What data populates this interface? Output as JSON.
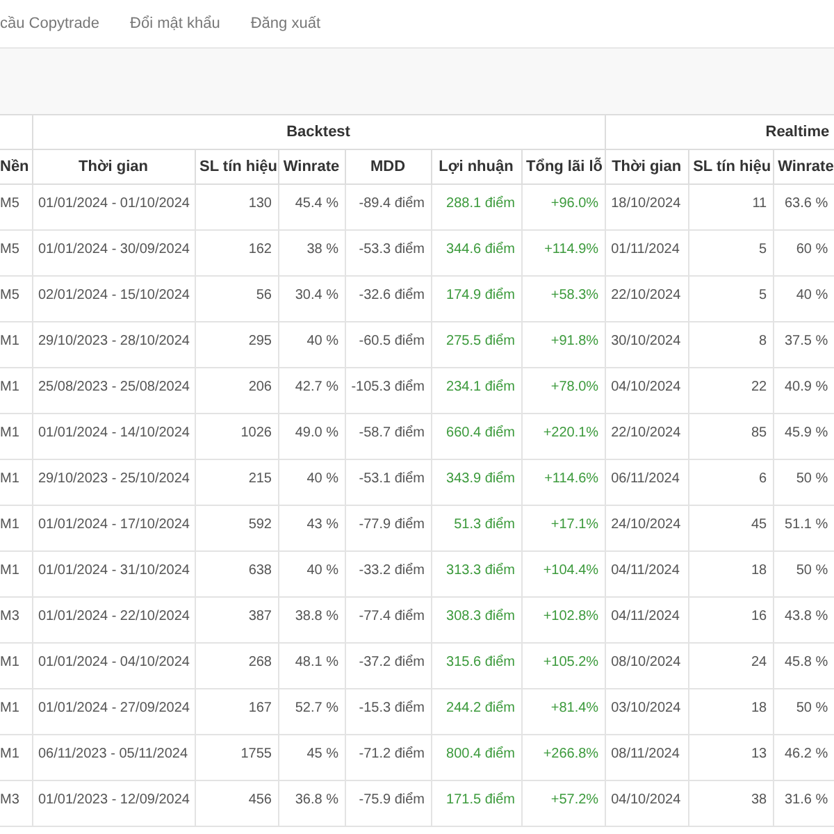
{
  "nav": {
    "items": [
      "cầu Copytrade",
      "Đổi mật khẩu",
      "Đăng xuất"
    ]
  },
  "table": {
    "groups": [
      {
        "label": "Backtest"
      },
      {
        "label": "Realtime"
      }
    ],
    "columns": [
      "Nền",
      "Thời gian",
      "SL tín hiệu",
      "Winrate",
      "MDD",
      "Lợi nhuận",
      "Tổng lãi lỗ",
      "Thời gian",
      "SL tín hiệu",
      "Winrate"
    ],
    "rows": [
      [
        "M5",
        "01/01/2024 - 01/10/2024",
        "130",
        "45.4 %",
        "-89.4 điểm",
        "288.1 điểm",
        "+96.0%",
        "18/10/2024",
        "11",
        "63.6 %"
      ],
      [
        "M5",
        "01/01/2024 - 30/09/2024",
        "162",
        "38 %",
        "-53.3 điểm",
        "344.6 điểm",
        "+114.9%",
        "01/11/2024",
        "5",
        "60 %"
      ],
      [
        "M5",
        "02/01/2024 - 15/10/2024",
        "56",
        "30.4 %",
        "-32.6 điểm",
        "174.9 điểm",
        "+58.3%",
        "22/10/2024",
        "5",
        "40 %"
      ],
      [
        "M1",
        "29/10/2023 - 28/10/2024",
        "295",
        "40 %",
        "-60.5 điểm",
        "275.5 điểm",
        "+91.8%",
        "30/10/2024",
        "8",
        "37.5 %"
      ],
      [
        "M1",
        "25/08/2023 - 25/08/2024",
        "206",
        "42.7 %",
        "-105.3 điểm",
        "234.1 điểm",
        "+78.0%",
        "04/10/2024",
        "22",
        "40.9 %"
      ],
      [
        "M1",
        "01/01/2024 - 14/10/2024",
        "1026",
        "49.0 %",
        "-58.7 điểm",
        "660.4 điểm",
        "+220.1%",
        "22/10/2024",
        "85",
        "45.9 %"
      ],
      [
        "M1",
        "29/10/2023 - 25/10/2024",
        "215",
        "40 %",
        "-53.1 điểm",
        "343.9 điểm",
        "+114.6%",
        "06/11/2024",
        "6",
        "50 %"
      ],
      [
        "M1",
        "01/01/2024 - 17/10/2024",
        "592",
        "43 %",
        "-77.9 điểm",
        "51.3 điểm",
        "+17.1%",
        "24/10/2024",
        "45",
        "51.1 %"
      ],
      [
        "M1",
        "01/01/2024 - 31/10/2024",
        "638",
        "40 %",
        "-33.2 điểm",
        "313.3 điểm",
        "+104.4%",
        "04/11/2024",
        "18",
        "50 %"
      ],
      [
        "M3",
        "01/01/2024 - 22/10/2024",
        "387",
        "38.8 %",
        "-77.4 điểm",
        "308.3 điểm",
        "+102.8%",
        "04/11/2024",
        "16",
        "43.8 %"
      ],
      [
        "M1",
        "01/01/2024 - 04/10/2024",
        "268",
        "48.1 %",
        "-37.2 điểm",
        "315.6 điểm",
        "+105.2%",
        "08/10/2024",
        "24",
        "45.8 %"
      ],
      [
        "M1",
        "01/01/2024 - 27/09/2024",
        "167",
        "52.7 %",
        "-15.3 điểm",
        "244.2 điểm",
        "+81.4%",
        "03/10/2024",
        "18",
        "50 %"
      ],
      [
        "M1",
        "06/11/2023 - 05/11/2024",
        "1755",
        "45 %",
        "-71.2 điểm",
        "800.4 điểm",
        "+266.8%",
        "08/11/2024",
        "13",
        "46.2 %"
      ],
      [
        "M3",
        "01/01/2023 - 12/09/2024",
        "456",
        "36.8 %",
        "-75.9 điểm",
        "171.5 điểm",
        "+57.2%",
        "04/10/2024",
        "38",
        "31.6 %"
      ]
    ]
  }
}
